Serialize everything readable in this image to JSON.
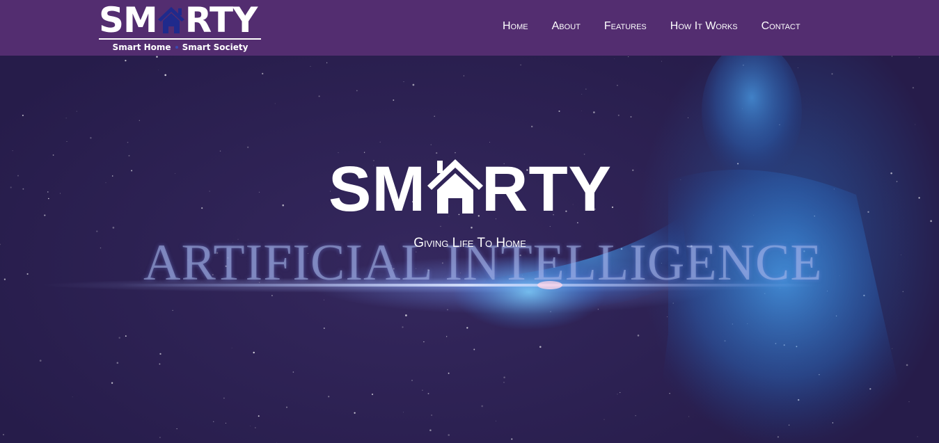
{
  "brand": {
    "logo_left": "SM",
    "logo_right": "RTY",
    "tag_left": "Smart Home",
    "tag_right": "Smart Society"
  },
  "nav": {
    "items": [
      "Home",
      "About",
      "Features",
      "How It Works",
      "Contact"
    ]
  },
  "hero": {
    "title_left": "SM",
    "title_right": "RTY",
    "subtitle": "Giving Life To Home",
    "background_text": "ARTIFICIAL INTELLIGENCE"
  },
  "colors": {
    "navbar": "#532d70",
    "logo_house": "#1f2a8c",
    "hero_bg": "#2a2150",
    "glow": "#5aa0ff"
  },
  "icons": {
    "logo_house": "house-icon",
    "hero_house": "house-icon"
  }
}
